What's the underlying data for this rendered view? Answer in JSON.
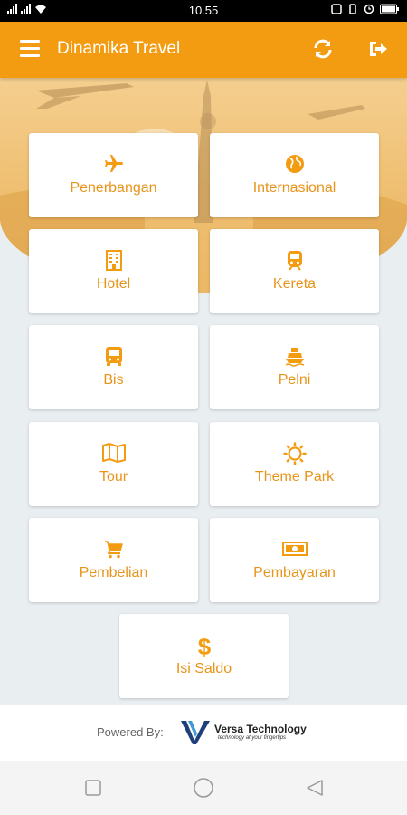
{
  "status": {
    "time": "10.55"
  },
  "appbar": {
    "title": "Dinamika Travel"
  },
  "menu": [
    {
      "label": "Penerbangan",
      "icon": "airplane-icon"
    },
    {
      "label": "Internasional",
      "icon": "globe-icon"
    },
    {
      "label": "Hotel",
      "icon": "hotel-icon"
    },
    {
      "label": "Kereta",
      "icon": "train-icon"
    },
    {
      "label": "Bis",
      "icon": "bus-icon"
    },
    {
      "label": "Pelni",
      "icon": "ship-icon"
    },
    {
      "label": "Tour",
      "icon": "map-icon"
    },
    {
      "label": "Theme Park",
      "icon": "sun-icon"
    },
    {
      "label": "Pembelian",
      "icon": "cart-icon"
    },
    {
      "label": "Pembayaran",
      "icon": "money-icon"
    },
    {
      "label": "Isi Saldo",
      "icon": "dollar-icon"
    }
  ],
  "footer": {
    "powered_by": "Powered By:",
    "brand": "Versa Technology",
    "tagline": "technology at your fingertips"
  },
  "colors": {
    "primary": "#f39c12",
    "label": "#e8941a",
    "background": "#e9eef1"
  }
}
